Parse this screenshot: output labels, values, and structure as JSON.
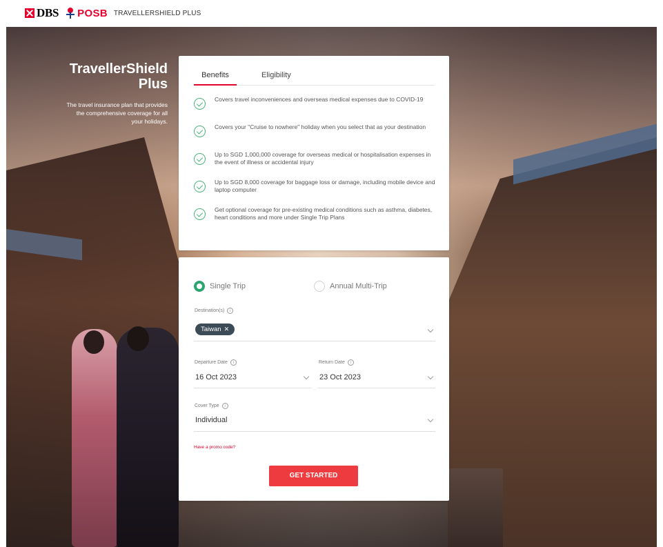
{
  "header": {
    "dbs_logo_text": "DBS",
    "posb_logo_text": "POSB",
    "product_name": "TRAVELLERSHIELD PLUS"
  },
  "hero": {
    "title_line1": "TravellerShield",
    "title_line2": "Plus",
    "subtitle": "The travel insurance plan that provides the comprehensive coverage for all your holidays."
  },
  "benefits_card": {
    "tabs": [
      {
        "label": "Benefits",
        "active": true
      },
      {
        "label": "Eligibility",
        "active": false
      }
    ],
    "items": [
      {
        "text": "Covers travel inconveniences and overseas medical expenses due to COVID-19",
        "icon": "check-circle-icon"
      },
      {
        "text": "Covers your \"Cruise to nowhere\" holiday when you select that as your destination",
        "icon": "check-circle-icon"
      },
      {
        "text": "Up to SGD 1,000,000 coverage for overseas medical or hospitalisation expenses in the event of illness or accidental injury",
        "icon": "check-circle-icon"
      },
      {
        "text": "Up to SGD 8,000 coverage for baggage loss or damage, including mobile device and laptop computer",
        "icon": "check-circle-icon"
      },
      {
        "text": "Get optional coverage for pre-existing medical conditions such as asthma, diabetes, heart conditions and more under Single Trip Plans",
        "icon": "check-circle-icon"
      }
    ]
  },
  "form": {
    "trip_options": [
      {
        "label": "Single Trip",
        "selected": true
      },
      {
        "label": "Annual Multi-Trip",
        "selected": false
      }
    ],
    "destination": {
      "label": "Destination(s)",
      "chips": [
        "Taiwan"
      ]
    },
    "departure": {
      "label": "Departure Date",
      "value": "16 Oct 2023"
    },
    "return": {
      "label": "Return Date",
      "value": "23 Oct 2023"
    },
    "cover_type": {
      "label": "Cover Type",
      "value": "Individual"
    },
    "promo_link": "Have a promo code?",
    "cta_label": "GET STARTED"
  },
  "colors": {
    "brand_red": "#e4002b",
    "check_green": "#49b67b",
    "radio_green": "#2aa56f",
    "cta_red": "#ee3b3f",
    "chip_bg": "#3d4b57"
  }
}
